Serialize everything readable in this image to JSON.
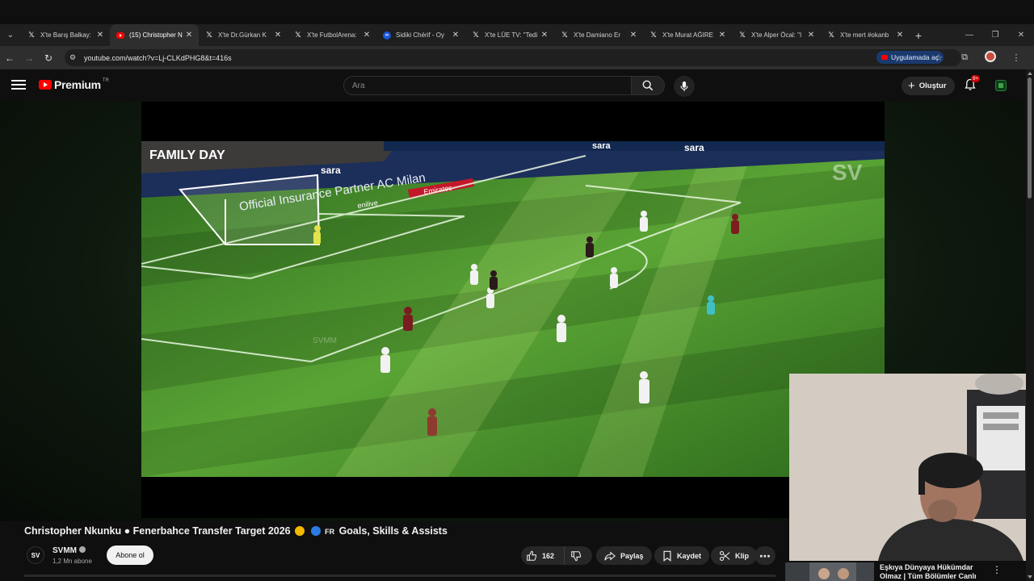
{
  "browser": {
    "tabs": [
      {
        "title": "X'te Barış Balkay:",
        "icon": "x-logo"
      },
      {
        "title": "(15) Christopher N",
        "icon": "youtube-logo",
        "active": true
      },
      {
        "title": "X'te Dr.Gürkan K",
        "icon": "x-logo"
      },
      {
        "title": "X'te FutbolArena:",
        "icon": "x-logo"
      },
      {
        "title": "Sidiki Chérif - Oy",
        "icon": "meta-logo"
      },
      {
        "title": "X'te LÜE TV: \"Tedi",
        "icon": "x-logo"
      },
      {
        "title": "X'te Damiano Er",
        "icon": "x-logo"
      },
      {
        "title": "X'te Murat AĞIRE",
        "icon": "x-logo"
      },
      {
        "title": "X'te Alper Öcal: \"I",
        "icon": "x-logo"
      },
      {
        "title": "X'te mert #okanb",
        "icon": "x-logo"
      }
    ],
    "url": "youtube.com/watch?v=Lj-CLKdPHG8&t=416s",
    "open_in_app_label": "Uygulamada aç"
  },
  "youtube": {
    "brand": "Premium",
    "region": "TR",
    "search_placeholder": "Ara",
    "create_label": "Oluştur",
    "notification_count": "9+"
  },
  "video": {
    "title": "Christopher Nkunku ● Fenerbahce Transfer Target 2026",
    "title_suffix_flag": "FR",
    "title_suffix": "Goals, Skills & Assists",
    "channel": "SVMM",
    "channel_initials": "SV",
    "subscribers": "1,2 Mn abone",
    "subscribe_label": "Abone ol",
    "likes": "162",
    "share_label": "Paylaş",
    "save_label": "Kaydet",
    "clip_label": "Klip",
    "pitch_banners": [
      "FAMILY DAY",
      "sara",
      "Official Insurance Partner AC Milan",
      "enilive",
      "Emirates",
      "SVMM"
    ],
    "watermark": "SV"
  },
  "recommendation": {
    "title": "Eşkıya Dünyaya Hükümdar Olmaz | Tüm Bölümler Canlı"
  },
  "colors": {
    "yt_red": "#ff0000",
    "background": "#0f0f0f",
    "pill": "#272727",
    "pitch": "#4f9a2c"
  }
}
